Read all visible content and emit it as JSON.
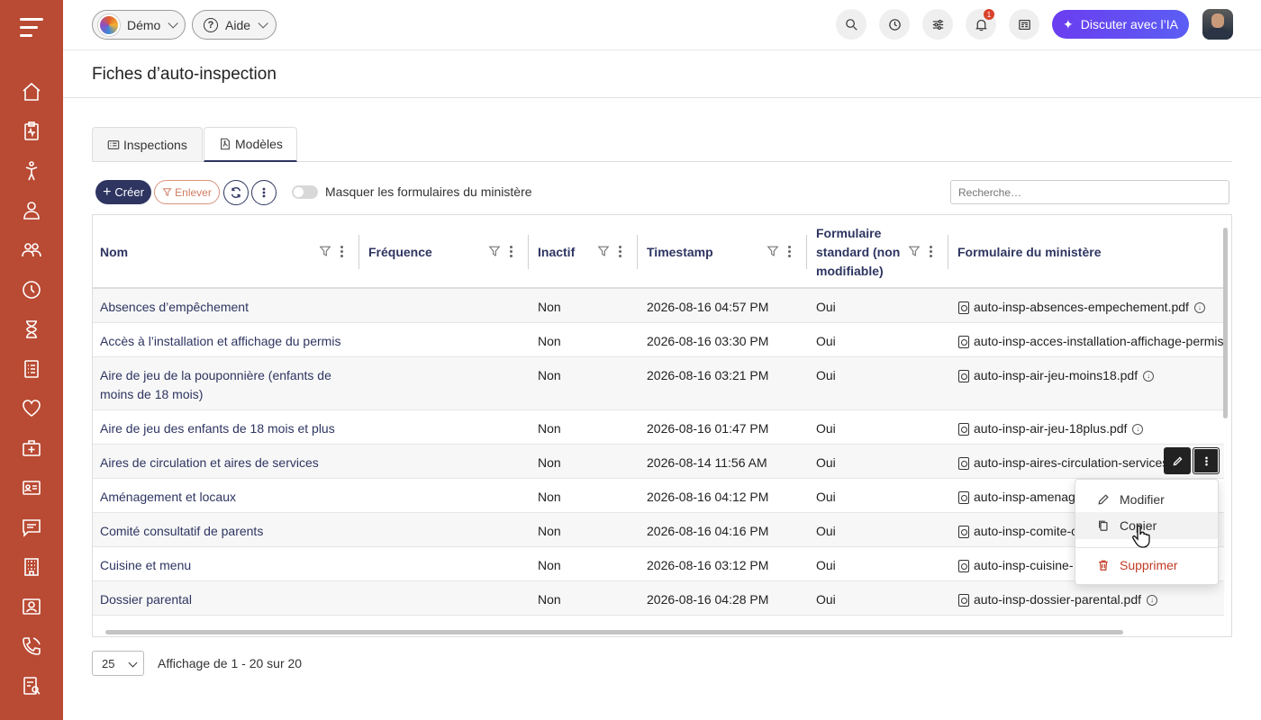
{
  "header": {
    "demo_label": "Démo",
    "help_label": "Aide",
    "notif_count": "1",
    "ai_label": "Discuter avec l’IA"
  },
  "page": {
    "title": "Fiches d’auto-inspection"
  },
  "tabs": [
    {
      "label": "Inspections",
      "active": false
    },
    {
      "label": "Modèles",
      "active": true
    }
  ],
  "toolbar": {
    "create_label": "Créer",
    "remove_label": "Enlever",
    "toggle_label": "Masquer les formulaires du ministère",
    "search_placeholder": "Recherche…"
  },
  "table": {
    "columns": {
      "name": "Nom",
      "frequency": "Fréquence",
      "inactive": "Inactif",
      "timestamp": "Timestamp",
      "standard_l1": "Formulaire",
      "standard_l2": "standard (non",
      "standard_l3": "modifiable)",
      "ministry": "Formulaire du ministère"
    },
    "rows": [
      {
        "name": "Absences d’empêchement",
        "inactive": "Non",
        "timestamp": "2026-08-16 04:57 PM",
        "standard": "Oui",
        "file": "auto-insp-absences-empechement.pdf"
      },
      {
        "name": "Accès à l’installation et affichage du permis",
        "inactive": "Non",
        "timestamp": "2026-08-16 03:30 PM",
        "standard": "Oui",
        "file": "auto-insp-acces-installation-affichage-permis"
      },
      {
        "name": "Aire de jeu de la pouponnière (enfants de moins de 18 mois)",
        "inactive": "Non",
        "timestamp": "2026-08-16 03:21 PM",
        "standard": "Oui",
        "file": "auto-insp-air-jeu-moins18.pdf"
      },
      {
        "name": "Aire de jeu des enfants de 18 mois et plus",
        "inactive": "Non",
        "timestamp": "2026-08-16 01:47 PM",
        "standard": "Oui",
        "file": "auto-insp-air-jeu-18plus.pdf"
      },
      {
        "name": "Aires de circulation et aires de services",
        "inactive": "Non",
        "timestamp": "2026-08-14 11:56 AM",
        "standard": "Oui",
        "file": "auto-insp-aires-circulation-services"
      },
      {
        "name": "Aménagement et locaux",
        "inactive": "Non",
        "timestamp": "2026-08-16 04:12 PM",
        "standard": "Oui",
        "file": "auto-insp-amenag"
      },
      {
        "name": "Comité consultatif de parents",
        "inactive": "Non",
        "timestamp": "2026-08-16 04:16 PM",
        "standard": "Oui",
        "file": "auto-insp-comite-c"
      },
      {
        "name": "Cuisine et menu",
        "inactive": "Non",
        "timestamp": "2026-08-16 03:12 PM",
        "standard": "Oui",
        "file": "auto-insp-cuisine-"
      },
      {
        "name": "Dossier parental",
        "inactive": "Non",
        "timestamp": "2026-08-16 04:28 PM",
        "standard": "Oui",
        "file": "auto-insp-dossier-parental.pdf"
      }
    ]
  },
  "context_menu": {
    "edit": "Modifier",
    "copy": "Copier",
    "delete": "Supprimer"
  },
  "pager": {
    "page_size": "25",
    "summary": "Affichage de 1 - 20 sur 20"
  },
  "colors": {
    "sidebar": "#b94a33",
    "primary": "#2e3561",
    "danger": "#c23b25",
    "ai_gradient_start": "#6b3df0"
  }
}
